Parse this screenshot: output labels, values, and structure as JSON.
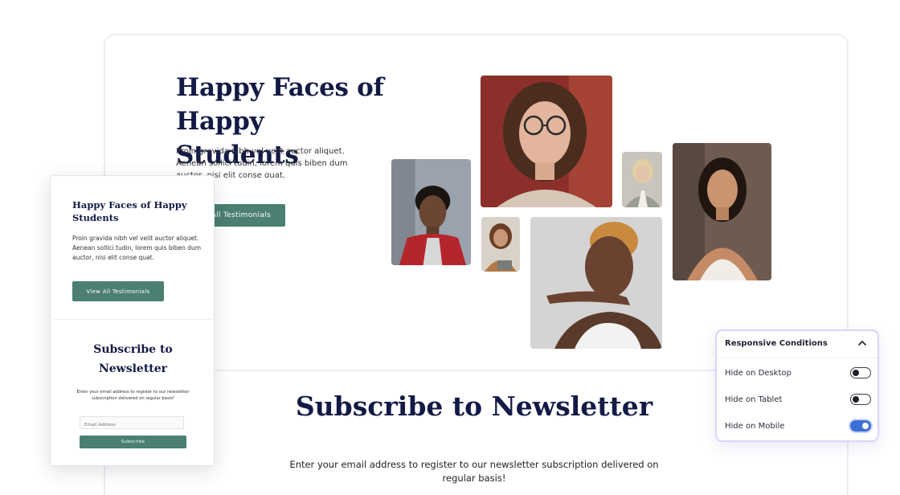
{
  "desktop": {
    "hero_title": "Happy Faces of Happy Students",
    "hero_text": "Proin gravida nibh vel velit auctor aliquet. Aenean sollici tudin, lorem quis biben dum auctor, nisi elit conse quat.",
    "hero_button": "View All Testimonials",
    "newsletter_title": "Subscribe to Newsletter",
    "newsletter_text": "Enter your email address to register to our newsletter subscription delivered on regular basis!"
  },
  "mobile": {
    "hero_title": "Happy Faces of Happy Students",
    "hero_text": "Proin gravida nibh vel velit auctor aliquet. Aenean sollici tudin, lorem quis biben dum auctor, nisi elit conse quat.",
    "hero_button": "View All Testimonials",
    "newsletter_title": "Subscribe to Newsletter",
    "newsletter_text": "Enter your email address to register to our newsletter subscription delivered on regular basis!",
    "email_placeholder": "Email Address",
    "subscribe_button": "Subscribe"
  },
  "responsive_panel": {
    "header": "Responsive Conditions",
    "rows": [
      {
        "label": "Hide on Desktop",
        "on": false
      },
      {
        "label": "Hide on Tablet",
        "on": false
      },
      {
        "label": "Hide on Mobile",
        "on": true
      }
    ]
  },
  "colors": {
    "heading": "#141a46",
    "button": "#4a7f71",
    "toggle_on": "#3c6fd6",
    "panel_border": "#d9d4ff"
  }
}
